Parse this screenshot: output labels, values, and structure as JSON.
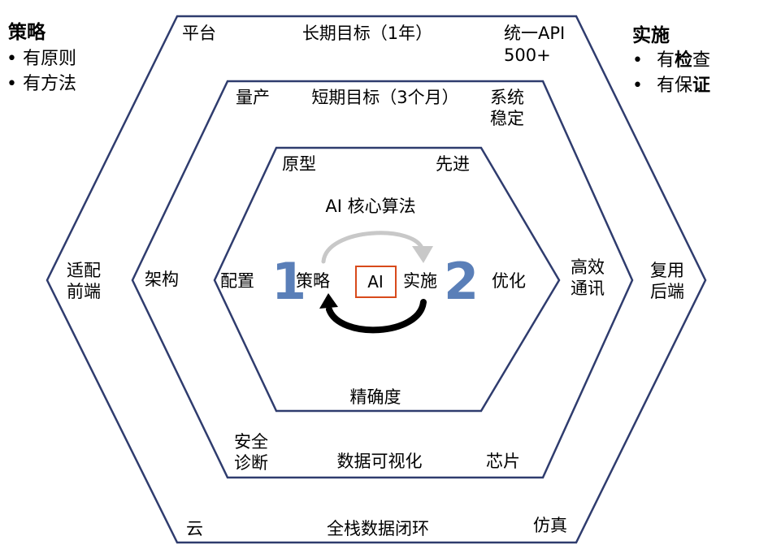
{
  "colors": {
    "hexagon_stroke": "#2f3c6e",
    "big_number": "#5a7fb8",
    "ai_box_border": "#d84a1b",
    "arrow_dark": "#000000",
    "arrow_light": "#c8c8c8"
  },
  "left_panel": {
    "title": "策略",
    "items": [
      "• 有原则",
      "• 有方法"
    ]
  },
  "right_panel": {
    "title": "实施",
    "items": [
      {
        "bullet": "•",
        "pre": "有",
        "bold": "检",
        "post": "查"
      },
      {
        "bullet": "•",
        "pre": "有保",
        "bold": "证",
        "post": ""
      }
    ]
  },
  "outer_hex": {
    "top_left": "平台",
    "top_center": "长期目标（1年）",
    "top_right": [
      "统一API",
      "500+"
    ],
    "left": [
      "适配",
      "前端"
    ],
    "right": [
      "复用",
      "后端"
    ],
    "bottom_left": "云",
    "bottom_center": "全栈数据闭环",
    "bottom_right": "仿真"
  },
  "middle_hex": {
    "top_left": "量产",
    "top_center": "短期目标（3个月）",
    "top_right": [
      "系统",
      "稳定"
    ],
    "left": "架构",
    "right": [
      "高效",
      "通讯"
    ],
    "bottom_left": [
      "安全",
      "诊断"
    ],
    "bottom_center": "数据可视化",
    "bottom_right": "芯片"
  },
  "inner_hex": {
    "top_left": "原型",
    "top_right": "先进",
    "top_center": "AI 核心算法",
    "left": "配置",
    "right": "优化",
    "bottom_center": "精确度"
  },
  "center": {
    "number_left": "1",
    "label_left": "策略",
    "ai_label": "AI",
    "label_right": "实施",
    "number_right": "2"
  }
}
